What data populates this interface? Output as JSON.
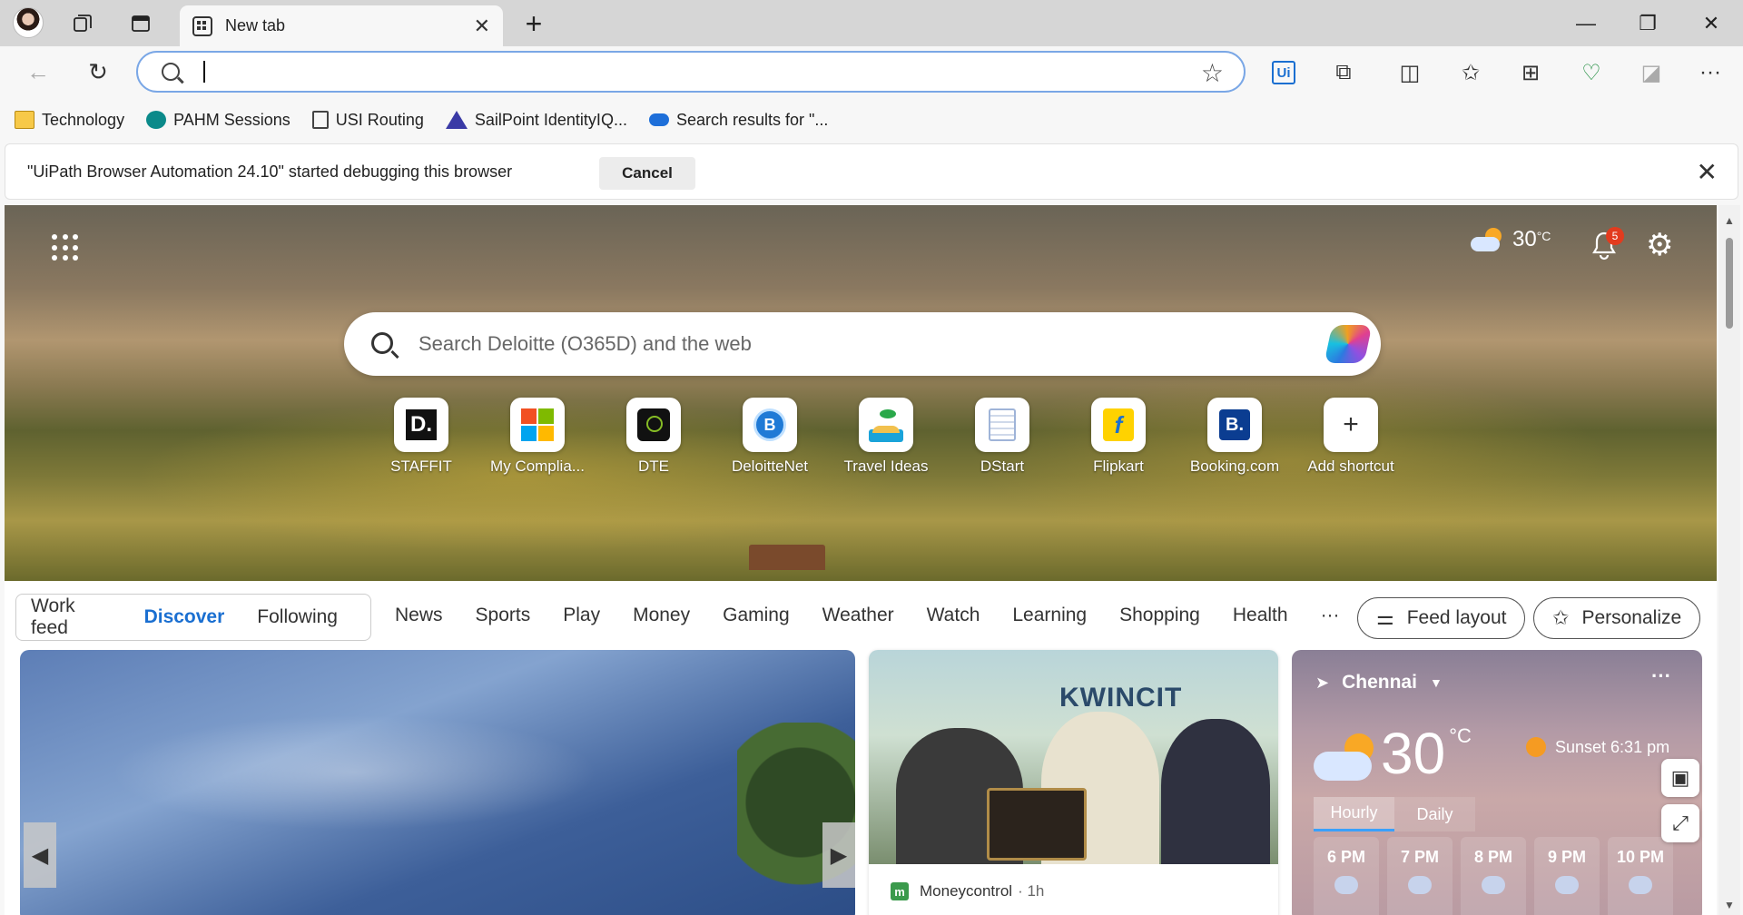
{
  "window": {
    "tab_title": "New tab",
    "new_tab_glyph": "+",
    "close_tab_glyph": "✕",
    "minimize_glyph": "—",
    "restore_glyph": "❐",
    "close_glyph": "✕"
  },
  "address_bar": {
    "value": "",
    "back_glyph": "←",
    "refresh_glyph": "↻",
    "favorite_glyph": "☆"
  },
  "toolbar": {
    "uipath_label": "Ui",
    "extensions_glyph": "⧉",
    "split_glyph": "◫",
    "favorites_glyph": "✩",
    "collections_glyph": "⊞",
    "health_glyph": "♡",
    "copilot_glyph": "◪",
    "more_glyph": "···"
  },
  "favorites": [
    {
      "label": "Technology",
      "icon": "folder-icon"
    },
    {
      "label": "PAHM Sessions",
      "icon": "sharepoint-icon"
    },
    {
      "label": "USI Routing",
      "icon": "document-icon"
    },
    {
      "label": "SailPoint IdentityIQ...",
      "icon": "sailpoint-icon"
    },
    {
      "label": "Search results for \"...",
      "icon": "cloud-icon"
    }
  ],
  "infobar": {
    "message": "\"UiPath Browser Automation 24.10\" started debugging this browser",
    "cancel_label": "Cancel",
    "close_glyph": "✕"
  },
  "hero": {
    "weather_temp": "30",
    "weather_unit": "°C",
    "notification_count": "5",
    "bell_glyph": "🔔",
    "gear_glyph": "⚙",
    "search_placeholder": "Search Deloitte (O365D) and the web"
  },
  "shortcuts": [
    {
      "label": "STAFFIT",
      "icon": "staffit-icon",
      "glyph": "D."
    },
    {
      "label": "My Complia...",
      "icon": "microsoft-icon",
      "glyph": ""
    },
    {
      "label": "DTE",
      "icon": "deloitte-dte-icon",
      "glyph": ""
    },
    {
      "label": "DeloitteNet",
      "icon": "deloittenet-icon",
      "glyph": "B"
    },
    {
      "label": "Travel Ideas",
      "icon": "beach-icon",
      "glyph": ""
    },
    {
      "label": "DStart",
      "icon": "dstart-icon",
      "glyph": ""
    },
    {
      "label": "Flipkart",
      "icon": "flipkart-icon",
      "glyph": "f"
    },
    {
      "label": "Booking.com",
      "icon": "booking-icon",
      "glyph": "B."
    },
    {
      "label": "Add shortcut",
      "icon": "plus-icon",
      "glyph": "+"
    }
  ],
  "feed_nav": {
    "segments": [
      {
        "label": "Work feed",
        "active": false
      },
      {
        "label": "Discover",
        "active": true
      },
      {
        "label": "Following",
        "active": false
      }
    ],
    "categories": [
      "News",
      "Sports",
      "Play",
      "Money",
      "Gaming",
      "Weather",
      "Watch",
      "Learning",
      "Shopping",
      "Health"
    ],
    "more_glyph": "···",
    "feed_layout_label": "Feed layout",
    "personalize_label": "Personalize"
  },
  "news_card": {
    "source": "Moneycontrol",
    "time": "· 1h",
    "logo_letter": "m",
    "image_text": "KWINCIT"
  },
  "weather_card": {
    "location": "Chennai",
    "temp": "30",
    "unit": "°C",
    "sunset": "Sunset 6:31 pm",
    "more_glyph": "···",
    "tabs": [
      {
        "label": "Hourly",
        "active": true
      },
      {
        "label": "Daily",
        "active": false
      }
    ],
    "hours": [
      "6 PM",
      "7 PM",
      "8 PM",
      "9 PM",
      "10 PM"
    ]
  },
  "colors": {
    "accent": "#1a6fd1",
    "badge": "#e23b1e"
  }
}
